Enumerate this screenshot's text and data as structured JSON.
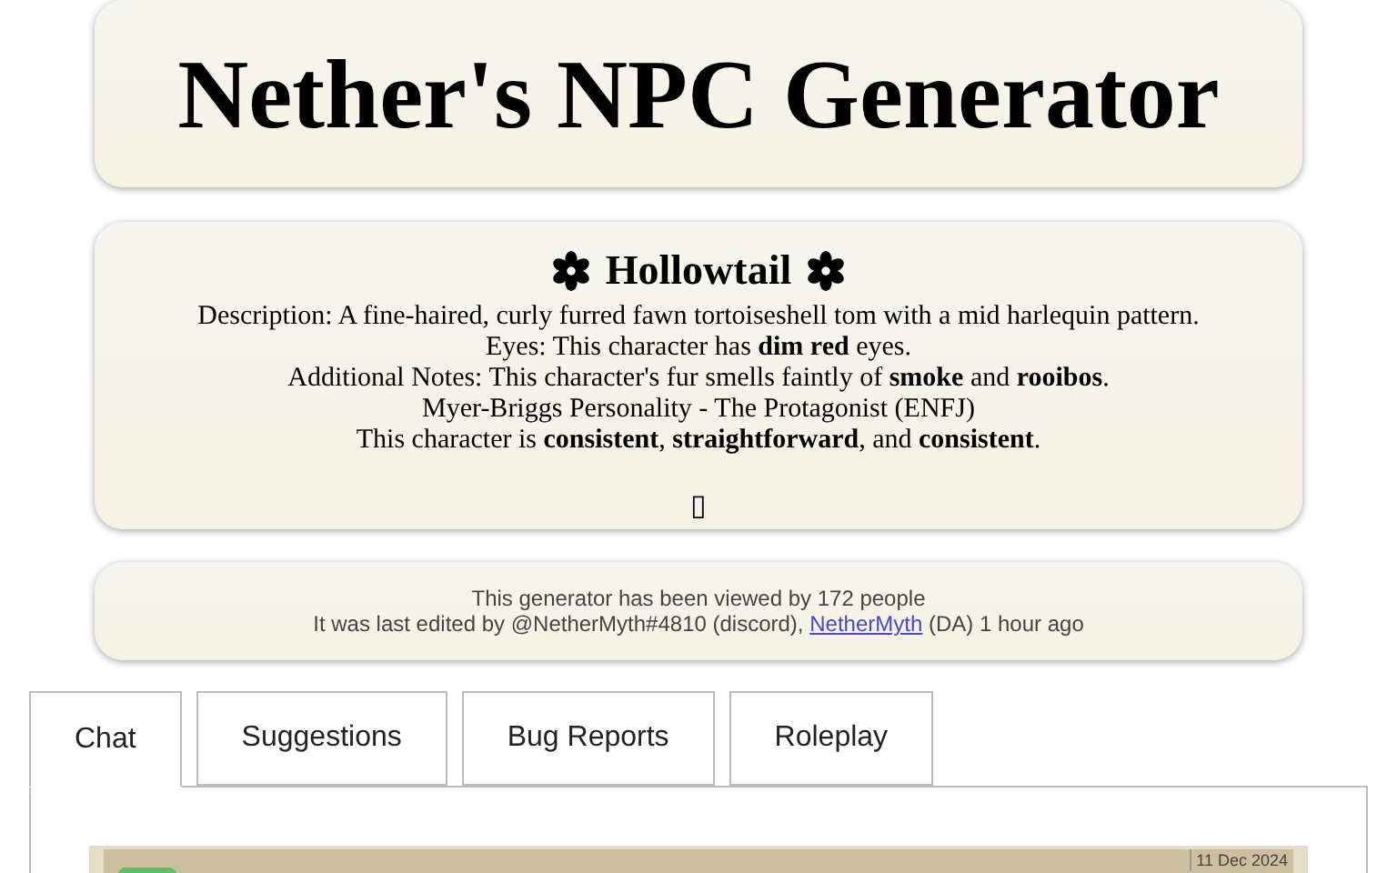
{
  "header": {
    "title": "Nether's NPC Generator"
  },
  "character": {
    "name": "Hollowtail",
    "lines": [
      "Description: A fine-haired, curly furred fawn tortoiseshell tom with a mid harlequin pattern.",
      "Eyes: This character has **dim red** eyes.",
      "Additional Notes: This character's fur smells faintly of **smoke** and **rooibos**.",
      "Myer-Briggs Personality - The Protagonist (ENFJ)",
      "This character is **consistent**, **straightforward**, and **consistent**."
    ],
    "glyph": "▯"
  },
  "stats": {
    "views": "This generator has been viewed by 172 people",
    "edited_prefix": "It was last edited by @NetherMyth#4810 (discord),",
    "link": "NetherMyth",
    "edited_suffix": "(DA) 1 hour ago"
  },
  "tabs": [
    {
      "label": "Chat",
      "selected": true
    },
    {
      "label": "Suggestions",
      "selected": false
    },
    {
      "label": "Bug Reports",
      "selected": false
    },
    {
      "label": "Roleplay",
      "selected": false
    }
  ],
  "chat": {
    "date": "11 Dec 2024"
  }
}
